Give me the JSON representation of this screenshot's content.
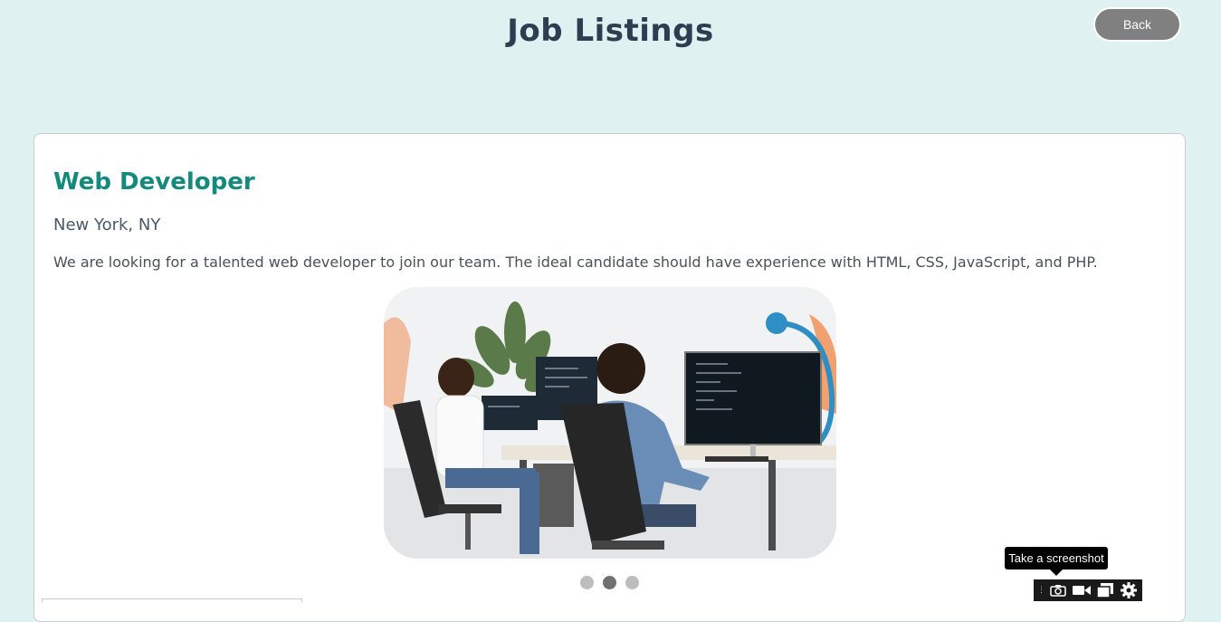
{
  "header": {
    "title": "Job Listings",
    "back_label": "Back"
  },
  "job": {
    "title": "Web Developer",
    "location": "New York, NY",
    "description": "We are looking for a talented web developer to join our team. The ideal candidate should have experience with HTML, CSS, JavaScript, and PHP."
  },
  "carousel": {
    "total_slides": 3,
    "active_index": 2
  },
  "screenshot_tool": {
    "tooltip": "Take a screenshot",
    "buttons": [
      "camera-icon",
      "video-icon",
      "window-icon",
      "gear-icon"
    ]
  },
  "colors": {
    "background": "#dff1f1",
    "title": "#2c3e50",
    "job_title": "#138a7c",
    "back_button": "#808080",
    "dot_active": "#717171",
    "dot_inactive": "#bdbdbd"
  }
}
